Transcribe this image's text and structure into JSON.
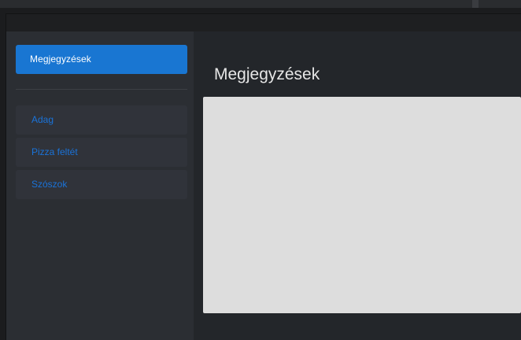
{
  "sidebar": {
    "active_item": {
      "label": "Megjegyzések"
    },
    "items": [
      {
        "label": "Adag"
      },
      {
        "label": "Pizza feltét"
      },
      {
        "label": "Szószok"
      }
    ]
  },
  "main": {
    "title": "Megjegyzések"
  },
  "colors": {
    "accent": "#1976d2",
    "sidebar_bg": "#2b2e33",
    "main_bg": "#23262a",
    "panel_bg": "#dddddd",
    "link_text": "#1a73d9"
  }
}
